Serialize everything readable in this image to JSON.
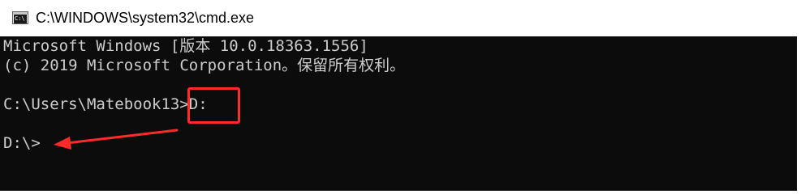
{
  "window": {
    "title": "C:\\WINDOWS\\system32\\cmd.exe",
    "icon": "cmd-icon",
    "icon_glyph": "C:\\"
  },
  "console": {
    "lines": [
      "Microsoft Windows [版本 10.0.18363.1556]",
      "(c) 2019 Microsoft Corporation。保留所有权利。",
      "",
      "C:\\Users\\Matebook13>D:",
      "",
      "D:\\>"
    ]
  },
  "annotations": {
    "color": "#ff2b2b"
  },
  "colors": {
    "console_background": "#0c0c0c",
    "console_text": "#cccccc"
  }
}
